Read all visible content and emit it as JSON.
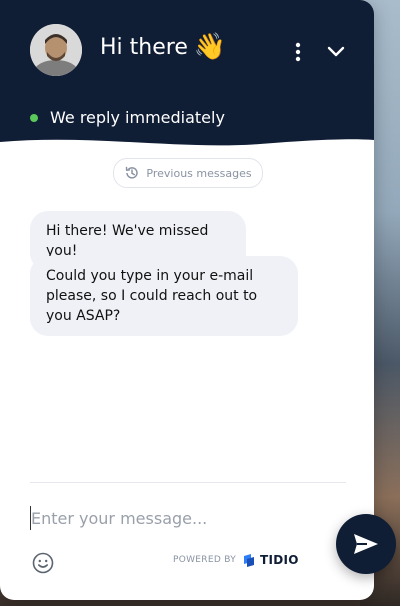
{
  "header": {
    "title": "Hi there",
    "wave_emoji": "👋",
    "status": "We reply immediately",
    "status_color": "#5ac85a",
    "background_color": "#0f1d35",
    "menu_icon": "more-vertical-icon",
    "collapse_icon": "chevron-down-icon"
  },
  "conversation": {
    "previous_messages_label": "Previous messages",
    "messages": [
      {
        "text": "Hi there! We've missed you!"
      },
      {
        "text": "Could you type in your e-mail please, so I could reach out to you ASAP?"
      }
    ]
  },
  "composer": {
    "placeholder": "Enter your message...",
    "value": "",
    "emoji_icon": "smiley-icon",
    "send_icon": "send-icon"
  },
  "footer": {
    "powered_by": "POWERED BY",
    "brand": "TIDIO"
  }
}
